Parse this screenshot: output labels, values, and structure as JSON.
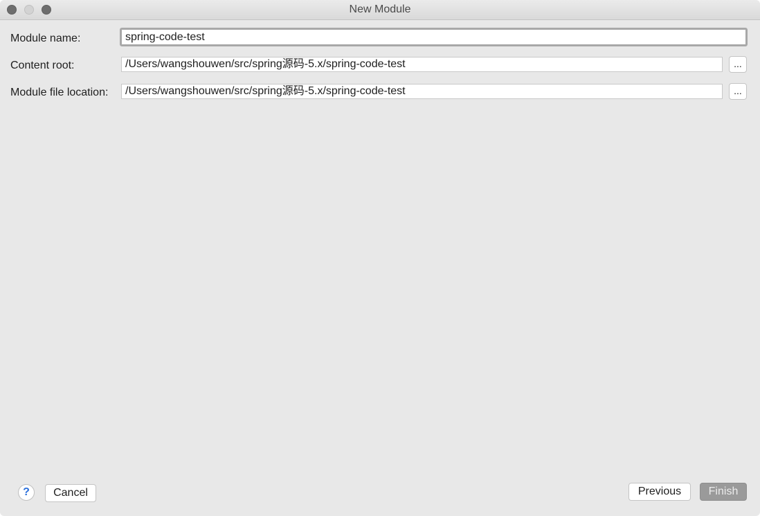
{
  "window": {
    "title": "New Module"
  },
  "form": {
    "module_name": {
      "label": "Module name:",
      "value": "spring-code-test"
    },
    "content_root": {
      "label": "Content root:",
      "value": "/Users/wangshouwen/src/spring源码-5.x/spring-code-test",
      "browse_label": "..."
    },
    "module_file_location": {
      "label": "Module file location:",
      "value": "/Users/wangshouwen/src/spring源码-5.x/spring-code-test",
      "browse_label": "..."
    }
  },
  "footer": {
    "help_label": "?",
    "cancel_label": "Cancel",
    "previous_label": "Previous",
    "finish_label": "Finish"
  },
  "icons": {
    "close": "close-icon",
    "minimize": "minimize-icon",
    "zoom": "zoom-icon",
    "help": "help-icon"
  },
  "colors": {
    "window_bg": "#e8e8e8",
    "finish_disabled": "#9a9a9a",
    "help_accent": "#2a6fdb"
  }
}
